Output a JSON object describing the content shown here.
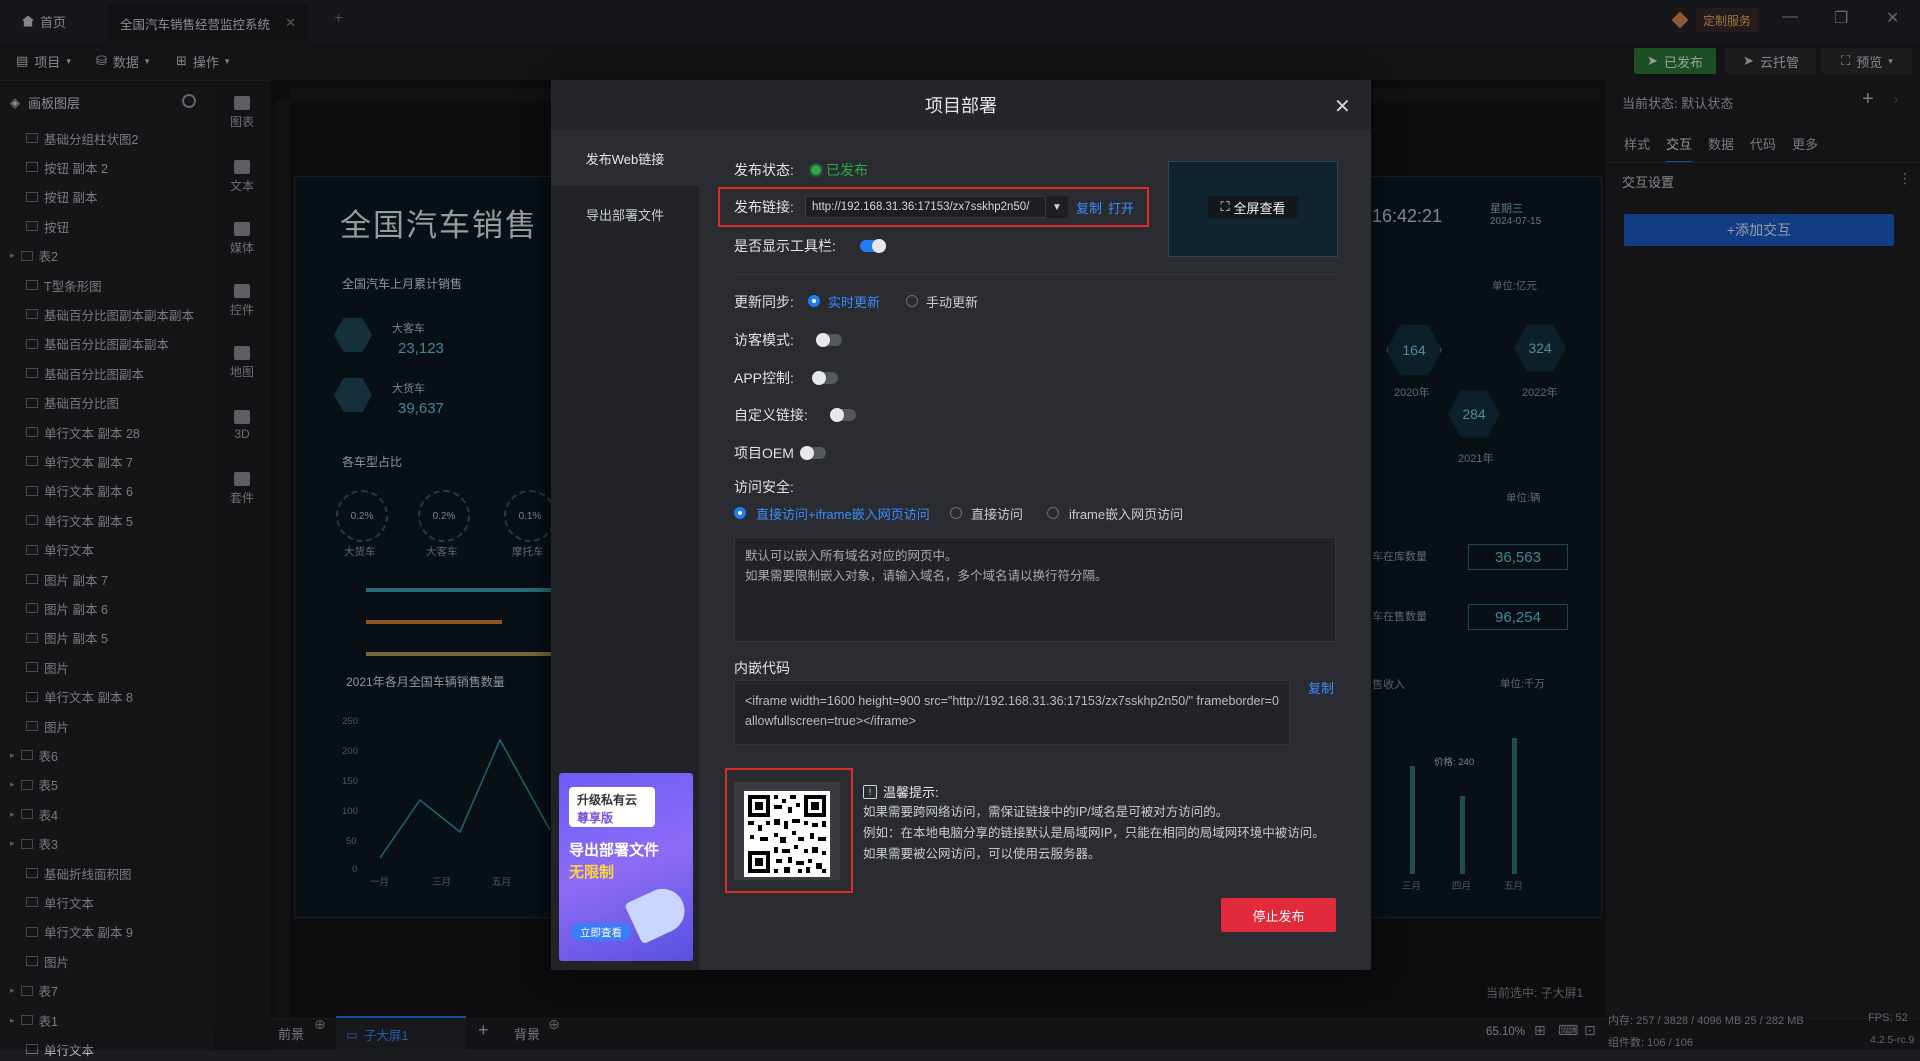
{
  "app": {
    "home_tab": "首页",
    "active_tab": "全国汽车销售经营监控系统",
    "custom_service": "定制服务"
  },
  "menu": {
    "project": "项目",
    "data": "数据",
    "operate": "操作"
  },
  "top_buttons": {
    "published": "已发布",
    "cloud": "云托管",
    "preview": "预览"
  },
  "layers_panel": {
    "title": "画板图层",
    "items": [
      "基础分组柱状图2",
      "按钮 副本 2",
      "按钮 副本",
      "按钮",
      "表2",
      "T型条形图",
      "基础百分比图副本副本副本",
      "基础百分比图副本副本",
      "基础百分比图副本",
      "基础百分比图",
      "单行文本 副本 28",
      "单行文本 副本 7",
      "单行文本 副本 6",
      "单行文本 副本 5",
      "单行文本",
      "图片 副本 7",
      "图片 副本 6",
      "图片 副本 5",
      "图片",
      "单行文本 副本 8",
      "图片",
      "表6",
      "表5",
      "表4",
      "表3",
      "基础折线面积图",
      "单行文本",
      "单行文本 副本 9",
      "图片",
      "表7",
      "表1",
      "单行文本"
    ]
  },
  "tools": [
    "图表",
    "文本",
    "媒体",
    "控件",
    "地图",
    "3D",
    "套件"
  ],
  "canvas": {
    "screen_title": "全国汽车销售",
    "time": "16:42:21",
    "weekday": "星期三",
    "date": "2024-07-15",
    "panel1_title": "全国汽车上月累计销售",
    "bus_label": "大客车",
    "bus_value": "23,123",
    "truck_label": "大货车",
    "truck_value": "39,637",
    "panel2_title": "各车型占比",
    "pct1": "0.2%",
    "pct2": "0.2%",
    "pct3": "0.1%",
    "pct_l1": "大货车",
    "pct_l2": "大客车",
    "pct_l3": "摩托车",
    "panel3_title": "2021年各月全国车辆销售数量",
    "yticks": [
      "250",
      "200",
      "150",
      "100",
      "50",
      "0"
    ],
    "xticks": [
      "一月",
      "三月",
      "五月"
    ],
    "hex_values": [
      "164",
      "324",
      "284"
    ],
    "hex_years": [
      "2020年",
      "2022年",
      "2021年"
    ],
    "unit_yi": "单位:亿元",
    "unit_liang": "单位:辆",
    "unit_qianwan": "单位:千万",
    "stock_label": "车在库数量",
    "stock_value": "36,563",
    "sale_label": "车在售数量",
    "sale_value": "96,254",
    "income_label": "售收入",
    "months_r": [
      "三月",
      "四月",
      "五月"
    ],
    "price_tip": "价格: 240",
    "selected_info": "当前选中: 子大屏1"
  },
  "right_panel": {
    "state": "当前状态: 默认状态",
    "tabs": [
      "样式",
      "交互",
      "数据",
      "代码",
      "更多"
    ],
    "section": "交互设置",
    "add_btn": "+添加交互"
  },
  "bottom": {
    "front": "前景",
    "sub": "子大屏1",
    "back": "背景",
    "zoom": "65.10%",
    "memory": "内存: 257 / 3828 / 4096 MB  25 / 282 MB",
    "components": "组件数: 106 / 106",
    "fps": "FPS: 52",
    "version": "4.2.5-rc.9"
  },
  "modal": {
    "title": "项目部署",
    "side_items": [
      "发布Web链接",
      "导出部署文件"
    ],
    "status_label": "发布状态:",
    "status_value": "已发布",
    "link_label": "发布链接:",
    "link_url": "http://192.168.31.36:17153/zx7sskhp2n50/",
    "copy": "复制",
    "open": "打开",
    "toolbar_label": "是否显示工具栏:",
    "fullscreen": "全屏查看",
    "sync_label": "更新同步:",
    "sync_realtime": "实时更新",
    "sync_manual": "手动更新",
    "visitor_label": "访客模式:",
    "app_label": "APP控制:",
    "custom_link_label": "自定义链接:",
    "oem_label": "项目OEM",
    "security_label": "访问安全:",
    "sec_opt1": "直接访问+iframe嵌入网页访问",
    "sec_opt2": "直接访问",
    "sec_opt3": "iframe嵌入网页访问",
    "textarea_line1": "默认可以嵌入所有域名对应的网页中。",
    "textarea_line2": "如果需要限制嵌入对象，请输入域名，多个域名请以换行符分隔。",
    "embed_label": "内嵌代码",
    "embed_code": "<iframe width=1600 height=900 src=\"http://192.168.31.36:17153/zx7sskhp2n50/\" frameborder=0 allowfullscreen=true></iframe>",
    "embed_copy": "复制",
    "tip_title": "温馨提示:",
    "tip1": "如果需要跨网络访问，需保证链接中的IP/域名是可被对方访问的。",
    "tip2": "例如：在本地电脑分享的链接默认是局域网IP，只能在相同的局域网环境中被访问。",
    "tip3": "如果需要被公网访问，可以使用云服务器。",
    "stop": "停止发布",
    "ad_line1": "升级私有云",
    "ad_line2": "尊享版",
    "ad_line3": "导出部署文件",
    "ad_line4": "无限制",
    "ad_btn": "立即查看"
  }
}
